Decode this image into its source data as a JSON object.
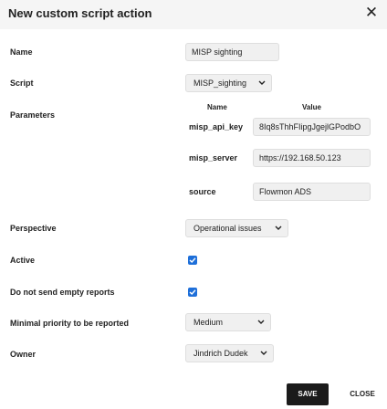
{
  "dialog": {
    "title": "New custom script action",
    "close_icon": "close-icon"
  },
  "form": {
    "name": {
      "label": "Name",
      "value": "MISP sighting"
    },
    "script": {
      "label": "Script",
      "value": "MISP_sighting"
    },
    "parameters": {
      "label": "Parameters",
      "col_name": "Name",
      "col_value": "Value",
      "rows": [
        {
          "name": "misp_api_key",
          "value": "8Iq8sThhFIipgJgejlGPodbO"
        },
        {
          "name": "misp_server",
          "value": "https://192.168.50.123"
        },
        {
          "name": "source",
          "value": "Flowmon ADS"
        }
      ]
    },
    "perspective": {
      "label": "Perspective",
      "value": "Operational issues"
    },
    "active": {
      "label": "Active",
      "checked": true
    },
    "no_empty_reports": {
      "label": "Do not send empty reports",
      "checked": true
    },
    "minimal_priority": {
      "label": "Minimal priority to be reported",
      "value": "Medium"
    },
    "owner": {
      "label": "Owner",
      "value": "Jindrich Dudek"
    }
  },
  "footer": {
    "save_label": "SAVE",
    "close_label": "CLOSE"
  },
  "colors": {
    "accent": "#1e6fd9",
    "save_button": "#1b1b1b",
    "header_bg": "#f5f5f5",
    "field_bg": "#f0f0f0"
  }
}
